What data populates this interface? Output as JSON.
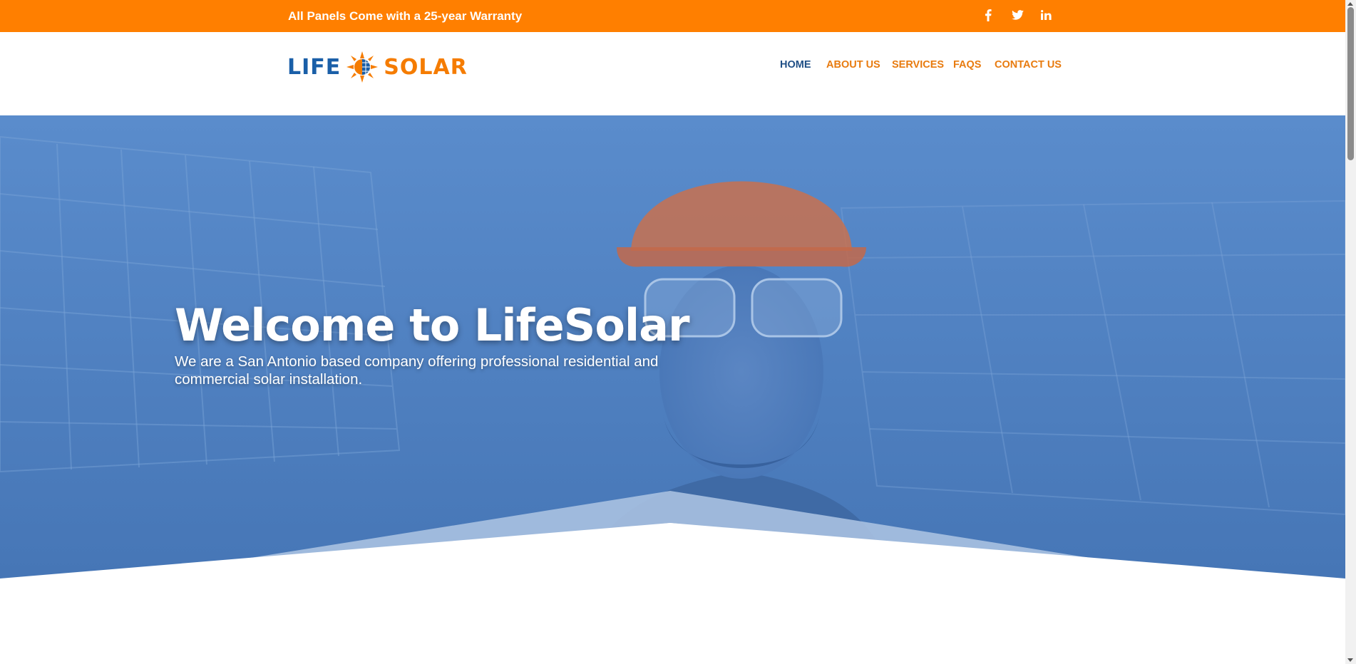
{
  "topbar": {
    "promo": "All Panels Come with a 25-year Warranty",
    "socials": [
      "facebook-icon",
      "twitter-icon",
      "linkedin-icon"
    ],
    "background": "#ff7f00"
  },
  "logo": {
    "word1": "LIFE",
    "word2": "SOLAR",
    "color1": "#1a5fa8",
    "color2": "#f57c00"
  },
  "nav": {
    "items": [
      {
        "label": "HOME",
        "active": true
      },
      {
        "label": "ABOUT US",
        "active": false
      },
      {
        "label": "SERVICES",
        "active": false
      },
      {
        "label": "FAQS",
        "active": false
      },
      {
        "label": "CONTACT US",
        "active": false
      }
    ],
    "active_color": "#1f4f86",
    "color": "#e87b0f"
  },
  "hero": {
    "title": "Welcome to LifeSolar",
    "subtitle": "We are a San Antonio based company offering professional residential and commercial solar installation.",
    "overlay_color": "#4c7fbf"
  }
}
